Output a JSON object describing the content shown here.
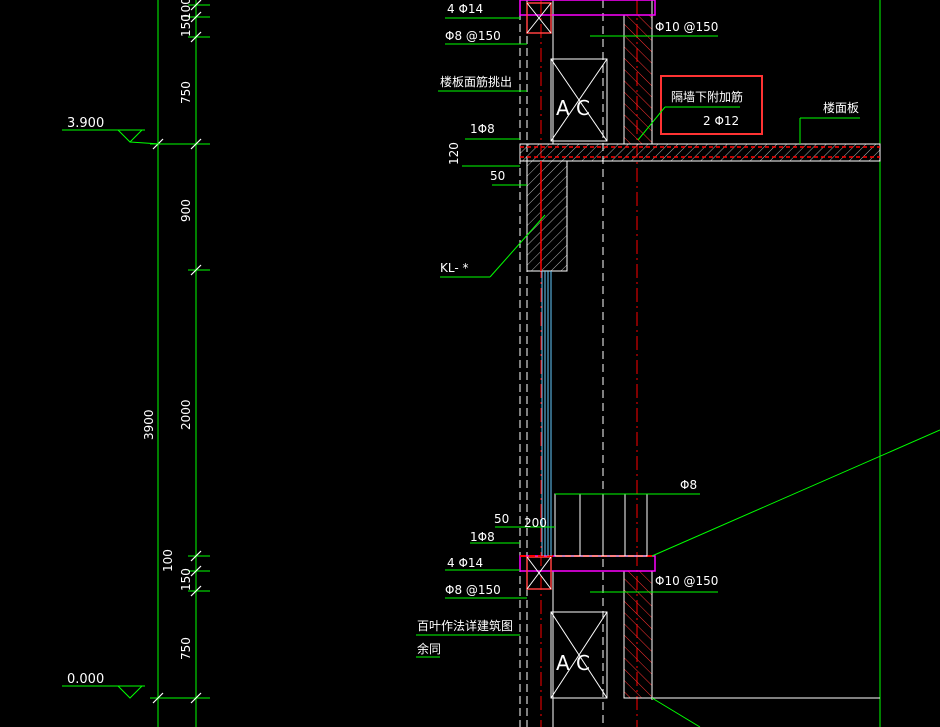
{
  "levels": {
    "upper": "3.900",
    "lower": "0.000"
  },
  "dims": {
    "top_100": "100",
    "top_150": "150",
    "top_750": "750",
    "mid_900": "900",
    "mid_2000": "2000",
    "total_3900": "3900",
    "bot_100": "100",
    "bot_150": "150",
    "bot_750": "750",
    "slab_120": "120",
    "gap_50_top": "50",
    "gap_50_bot": "50",
    "w_200": "200"
  },
  "labels": {
    "top_4phi14": "4 Φ14",
    "top_phi8_150": "Φ8 @150",
    "top_phi10_150": "Φ10 @150",
    "slab_bar_out": "楼板面筋挑出",
    "one_phi8_top": "1Φ8",
    "beam_kl": "KL- *",
    "wall_add_bars_title": "隔墙下附加筋",
    "wall_add_bars_value": "2 Φ12",
    "floor_slab": "楼面板",
    "phi8_mid": "Φ8",
    "one_phi8_bot": "1Φ8",
    "bot_4phi14": "4 Φ14",
    "bot_phi8_150": "Φ8 @150",
    "bot_phi10_150": "Φ10 @150",
    "louver_note": "百叶作法详建筑图",
    "rest_same": "余同",
    "ac_top": "A C",
    "ac_bot": "A C"
  },
  "colors": {
    "background": "#000000",
    "dimension": "#00ff00",
    "text": "#ffffff",
    "rebar": "#ff0000",
    "stirrup": "#ff00ff",
    "highlight": "#ff3333",
    "glass": "#66ccff"
  }
}
